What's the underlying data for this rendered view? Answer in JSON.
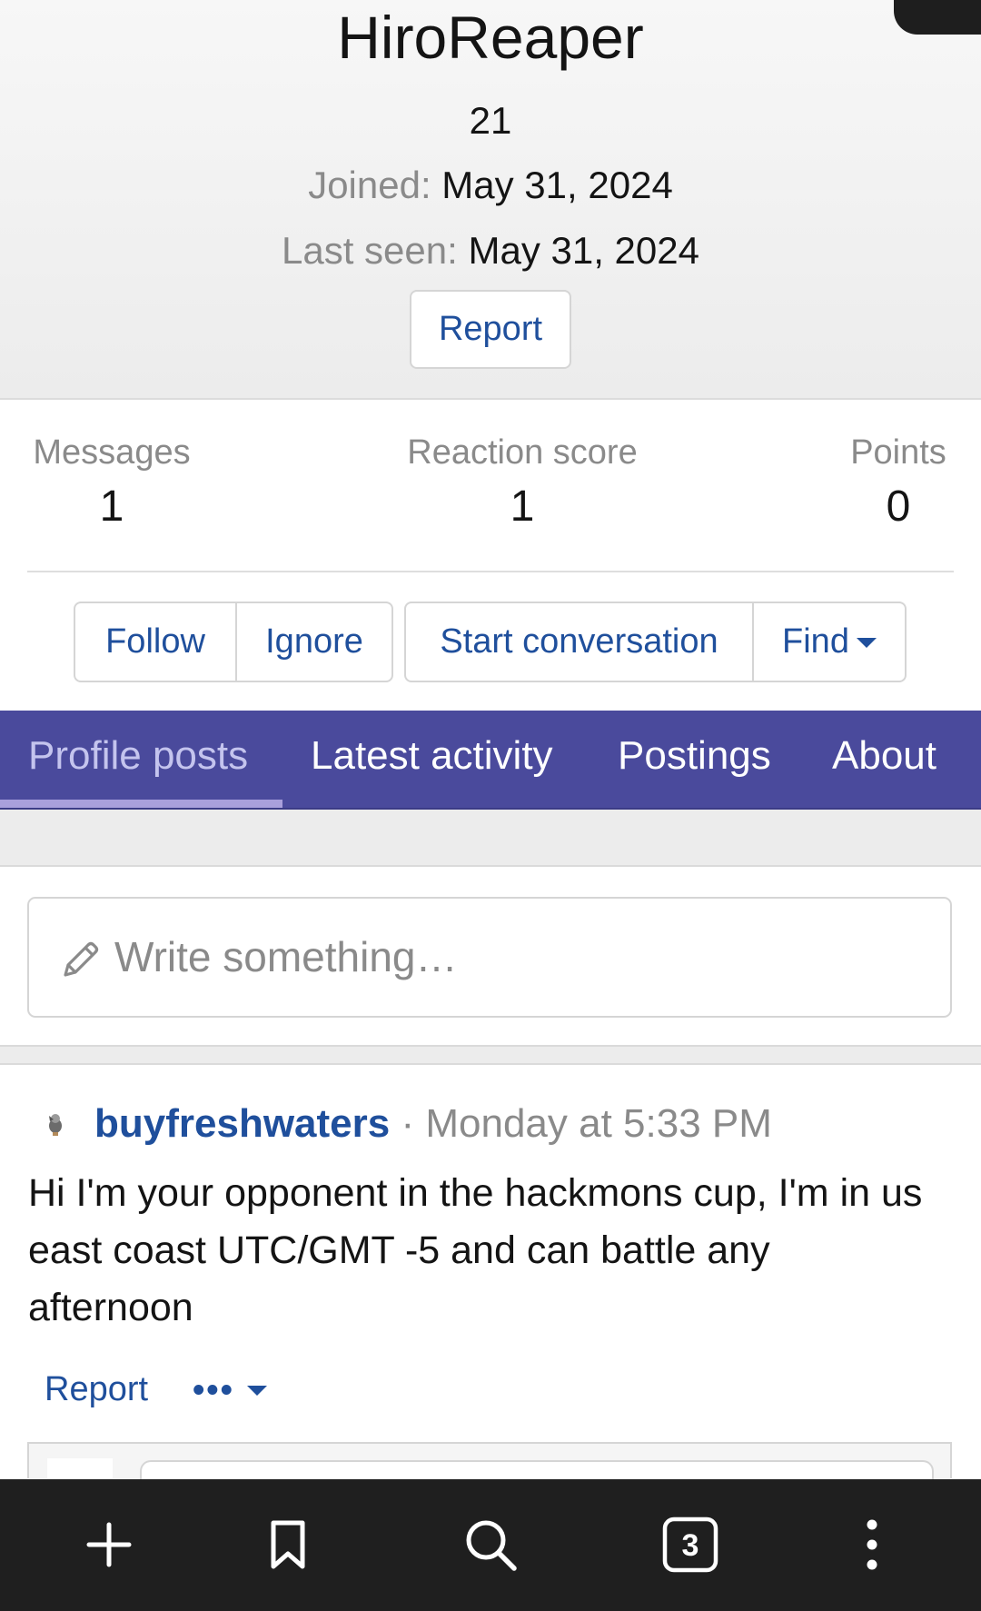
{
  "profile": {
    "username": "HiroReaper",
    "user_title": "21",
    "joined_label": "Joined:",
    "joined_value": "May 31, 2024",
    "last_seen_label": "Last seen:",
    "last_seen_value": "May 31, 2024",
    "report_label": "Report"
  },
  "stats": {
    "messages_label": "Messages",
    "messages_value": "1",
    "reaction_label": "Reaction score",
    "reaction_value": "1",
    "points_label": "Points",
    "points_value": "0"
  },
  "actions": {
    "follow": "Follow",
    "ignore": "Ignore",
    "start_conversation": "Start conversation",
    "find": "Find"
  },
  "tabs": [
    {
      "label": "Profile posts",
      "active": true
    },
    {
      "label": "Latest activity",
      "active": false
    },
    {
      "label": "Postings",
      "active": false
    },
    {
      "label": "About",
      "active": false
    }
  ],
  "composer": {
    "placeholder": "Write something…"
  },
  "post": {
    "author": "buyfreshwaters",
    "separator": "·",
    "time": "Monday at 5:33 PM",
    "body": "Hi I'm your opponent in the hackmons cup, I'm in us east coast UTC/GMT -5 and can battle any afternoon",
    "report_label": "Report",
    "more_label": "•••"
  },
  "browser_bar": {
    "tab_count": "3",
    "icons": [
      "plus-icon",
      "bookmark-icon",
      "search-icon",
      "tabs-icon",
      "menu-icon"
    ]
  },
  "colors": {
    "link": "#1f4f9c",
    "tab_bar": "#4a4a9c",
    "tab_active": "#c4c4ee",
    "muted": "#8a8a8a"
  }
}
